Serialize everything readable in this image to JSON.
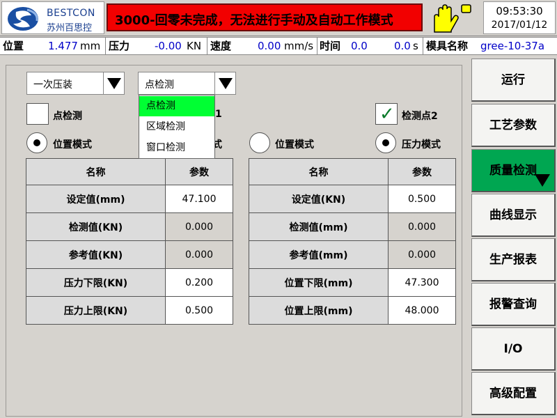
{
  "header": {
    "brand": "BESTCON",
    "brand_cn": "苏州百思控",
    "alarm_text": "3000-回零未完成，无法进行手动及自动工作模式",
    "time": "09:53:30",
    "date": "2017/01/12"
  },
  "status": {
    "position_label": "位置",
    "position_value": "1.477",
    "position_unit": "mm",
    "pressure_label": "压力",
    "pressure_value": "-0.00",
    "pressure_unit": "KN",
    "speed_label": "速度",
    "speed_value": "0.00",
    "speed_unit": "mm/s",
    "time_label": "时间",
    "time_value1": "0.0",
    "time_value2": "0.0",
    "time_unit": "s",
    "mold_label": "模具名称",
    "mold_value": "gree-10-37a"
  },
  "controls": {
    "press_mode": "一次压装",
    "detect_type": "点检测",
    "dropdown_options": [
      "点检测",
      "区域检测",
      "窗口检测"
    ],
    "left_checkbox_label": "点检测",
    "right_checkbox_label": "检测点2",
    "left_radio_label": "位置模式",
    "mid_fragment": "1",
    "mid_radio_fragment": "式",
    "right_radio1_label": "位置模式",
    "right_radio2_label": "压力模式"
  },
  "left_table": {
    "headers": [
      "名称",
      "参数"
    ],
    "rows": [
      {
        "name": "设定值(mm)",
        "value": "47.100"
      },
      {
        "name": "检测值(KN)",
        "value": "0.000"
      },
      {
        "name": "参考值(KN)",
        "value": "0.000"
      },
      {
        "name": "压力下限(KN)",
        "value": "0.200"
      },
      {
        "name": "压力上限(KN)",
        "value": "0.500"
      }
    ]
  },
  "right_table": {
    "headers": [
      "名称",
      "参数"
    ],
    "rows": [
      {
        "name": "设定值(KN)",
        "value": "0.500"
      },
      {
        "name": "检测值(mm)",
        "value": "0.000"
      },
      {
        "name": "参考值(mm)",
        "value": "0.000"
      },
      {
        "name": "位置下限(mm)",
        "value": "47.300"
      },
      {
        "name": "位置上限(mm)",
        "value": "48.000"
      }
    ]
  },
  "menu": {
    "items": [
      "运行",
      "工艺参数",
      "质量检测",
      "曲线显示",
      "生产报表",
      "报警查询",
      "I/O",
      "高级配置"
    ],
    "active": "质量检测"
  },
  "colors": {
    "alarm": "#f20000",
    "active_menu": "#00a651",
    "selected_option": "#00ff33",
    "value_text": "#0000c8"
  }
}
